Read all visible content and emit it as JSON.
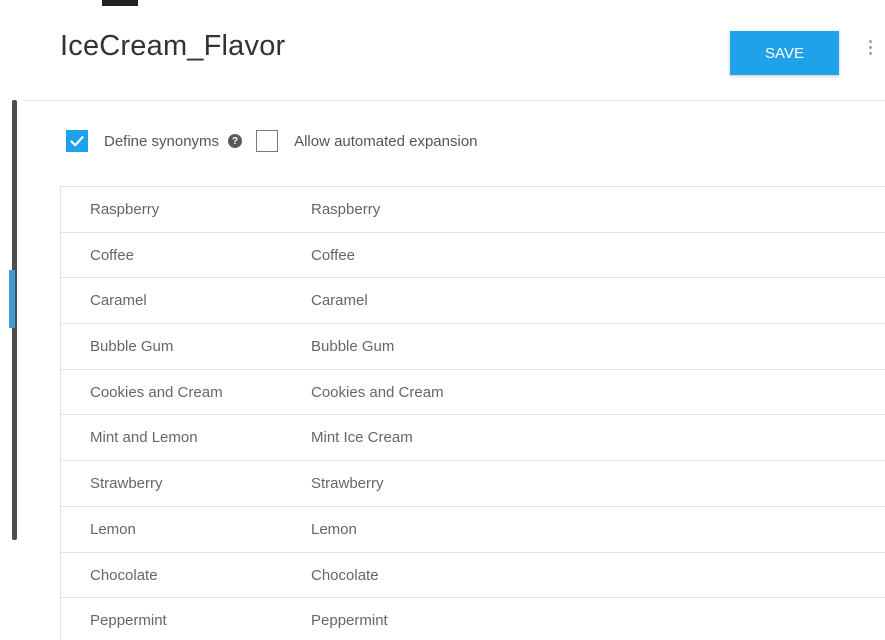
{
  "header": {
    "title": "IceCream_Flavor",
    "save_label": "SAVE"
  },
  "options": {
    "define_synonyms": {
      "label": "Define synonyms",
      "checked": true
    },
    "allow_expansion": {
      "label": "Allow automated expansion",
      "checked": false
    }
  },
  "entries": [
    {
      "value": "Raspberry",
      "synonym": "Raspberry"
    },
    {
      "value": "Coffee",
      "synonym": "Coffee"
    },
    {
      "value": "Caramel",
      "synonym": "Caramel"
    },
    {
      "value": "Bubble Gum",
      "synonym": "Bubble Gum"
    },
    {
      "value": "Cookies and Cream",
      "synonym": "Cookies and Cream"
    },
    {
      "value": "Mint and Lemon",
      "synonym": "Mint Ice Cream"
    },
    {
      "value": "Strawberry",
      "synonym": "Strawberry"
    },
    {
      "value": "Lemon",
      "synonym": "Lemon"
    },
    {
      "value": "Chocolate",
      "synonym": "Chocolate"
    },
    {
      "value": "Peppermint",
      "synonym": "Peppermint"
    }
  ],
  "colors": {
    "accent": "#1fa2ea",
    "text": "#666666",
    "border": "#e2e2e2"
  }
}
